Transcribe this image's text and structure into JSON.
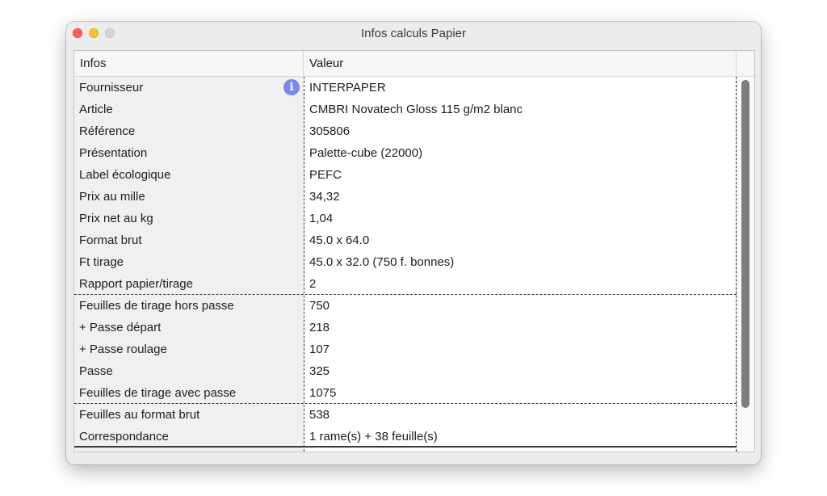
{
  "window": {
    "title": "Infos calculs Papier"
  },
  "table": {
    "columns": [
      "Infos",
      "Valeur"
    ],
    "rows": [
      {
        "key": "Fournisseur",
        "value": "INTERPAPER"
      },
      {
        "key": "Article",
        "value": "CMBRI Novatech Gloss 115 g/m2 blanc"
      },
      {
        "key": "Référence",
        "value": "305806"
      },
      {
        "key": "Présentation",
        "value": "Palette-cube (22000)"
      },
      {
        "key": "Label écologique",
        "value": "PEFC"
      },
      {
        "key": "Prix au mille",
        "value": "34,32"
      },
      {
        "key": "Prix net au kg",
        "value": "1,04"
      },
      {
        "key": "Format brut",
        "value": "45.0 x 64.0"
      },
      {
        "key": "Ft tirage",
        "value": "45.0 x 32.0 (750 f. bonnes)"
      },
      {
        "key": "Rapport papier/tirage",
        "value": "2"
      },
      {
        "key": "Feuilles de tirage hors passe",
        "value": "750"
      },
      {
        "key": "+ Passe départ",
        "value": "218"
      },
      {
        "key": "+ Passe roulage",
        "value": "107"
      },
      {
        "key": "Passe",
        "value": "325"
      },
      {
        "key": "Feuilles de tirage avec passe",
        "value": "1075"
      },
      {
        "key": "Feuilles au format brut",
        "value": "538"
      },
      {
        "key": "Correspondance",
        "value": "1 rame(s) + 38 feuille(s)"
      }
    ],
    "info_icon_glyph": "i"
  }
}
